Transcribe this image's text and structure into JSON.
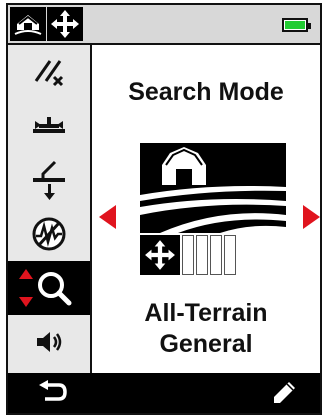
{
  "colors": {
    "battery_fill": "#22cc33",
    "arrow": "#e0141e",
    "background": "#ffffff",
    "active_item": "#000000"
  },
  "top_bar": {
    "icons": [
      "home-field-icon",
      "pan-arrows-icon"
    ],
    "battery_icon": "battery-icon"
  },
  "sidebar": {
    "items": [
      {
        "icon": "sensitivity-slash-icon",
        "active": false
      },
      {
        "icon": "ground-balance-icon",
        "active": false
      },
      {
        "icon": "threshold-icon",
        "active": false
      },
      {
        "icon": "noise-cancel-icon",
        "active": false
      },
      {
        "icon": "search-mode-icon",
        "active": true
      },
      {
        "icon": "volume-icon",
        "active": false
      }
    ]
  },
  "main": {
    "title": "Search Mode",
    "mode_name_line1": "All-Terrain",
    "mode_name_line2": "General",
    "mode_image_icon": "farm-barn-icon",
    "pan_icon": "pan-arrows-icon",
    "selected_mode_index": 1,
    "mode_count": 4
  },
  "bottom_bar": {
    "back_icon": "back-arrow-icon",
    "edit_icon": "pencil-icon"
  }
}
